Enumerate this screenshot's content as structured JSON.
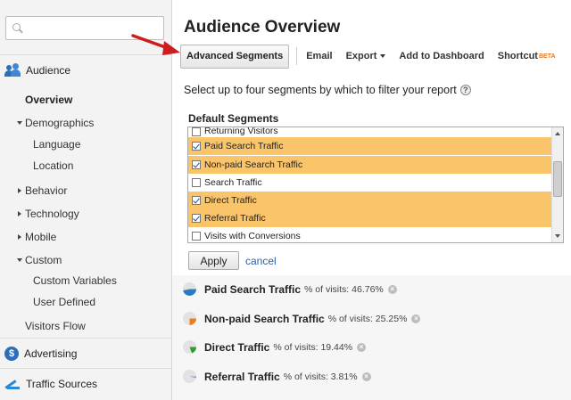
{
  "sidebar": {
    "search_value": "",
    "audience_label": "Audience",
    "items": {
      "overview": "Overview",
      "demographics": "Demographics",
      "language": "Language",
      "location": "Location",
      "behavior": "Behavior",
      "technology": "Technology",
      "mobile": "Mobile",
      "custom": "Custom",
      "custom_variables": "Custom Variables",
      "user_defined": "User Defined",
      "visitors_flow": "Visitors Flow"
    },
    "advertising_label": "Advertising",
    "advertising_icon": "$",
    "traffic_label": "Traffic Sources"
  },
  "main": {
    "title": "Audience Overview",
    "toolbar": {
      "advanced_segments": "Advanced Segments",
      "email": "Email",
      "export": "Export",
      "add_to_dashboard": "Add to Dashboard",
      "shortcut": "Shortcut",
      "beta": "BETA"
    },
    "instruction": "Select up to four segments by which to filter your report",
    "help_icon": "?",
    "default_segments_title": "Default Segments",
    "segment_options": [
      {
        "label": "Returning Visitors",
        "checked": false,
        "selected": false
      },
      {
        "label": "Paid Search Traffic",
        "checked": true,
        "selected": true
      },
      {
        "label": "Non-paid Search Traffic",
        "checked": true,
        "selected": true
      },
      {
        "label": "Search Traffic",
        "checked": false,
        "selected": false
      },
      {
        "label": "Direct Traffic",
        "checked": true,
        "selected": true
      },
      {
        "label": "Referral Traffic",
        "checked": true,
        "selected": true
      },
      {
        "label": "Visits with Conversions",
        "checked": false,
        "selected": false
      }
    ],
    "apply_label": "Apply",
    "cancel_label": "cancel",
    "active_segments": [
      {
        "name": "Paid Search Traffic",
        "pct": "% of visits: 46.76%",
        "color": "#2b7bc4",
        "fraction": 0.4676
      },
      {
        "name": "Non-paid Search Traffic",
        "pct": "% of visits: 25.25%",
        "color": "#ef7d1e",
        "fraction": 0.2525
      },
      {
        "name": "Direct Traffic",
        "pct": "% of visits: 19.44%",
        "color": "#2e9e2e",
        "fraction": 0.1944
      },
      {
        "name": "Referral Traffic",
        "pct": "% of visits: 3.81%",
        "color": "#b57bd3",
        "fraction": 0.0381
      }
    ],
    "remove_icon": "×"
  },
  "colors": {
    "selected_row": "#f9c46a",
    "link": "#2a5db0",
    "annotation_arrow": "#cc1e1e"
  }
}
